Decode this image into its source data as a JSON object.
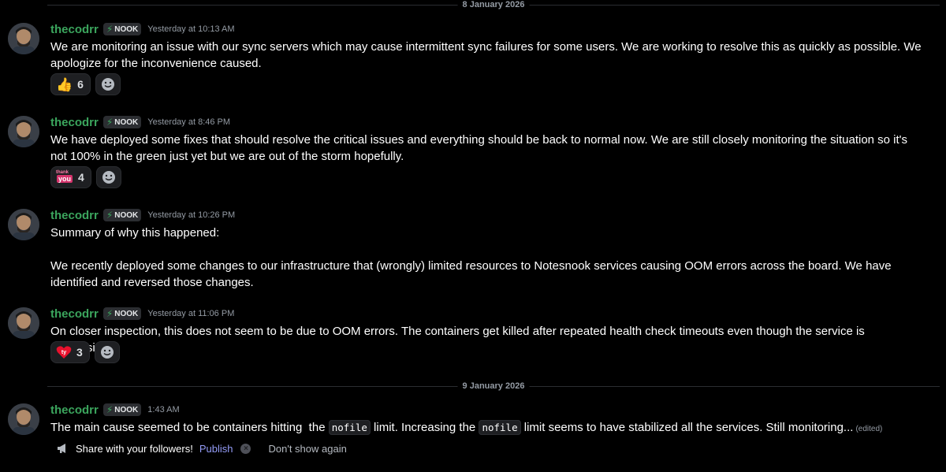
{
  "dividers": [
    "8 January 2026",
    "9 January 2026"
  ],
  "icons": {
    "bolt": "lightning-bolt-icon",
    "add_reaction": "smiley-add-reaction-icon",
    "megaphone": "megaphone-icon",
    "dismiss": "close-circle-icon"
  },
  "colors": {
    "username": "#3ba55d",
    "link": "#949cf7",
    "background": "#000000"
  },
  "messages": [
    {
      "author": "thecodrr",
      "tag": "NOOK",
      "time": "Yesterday at 10:13 AM",
      "paragraphs": [
        "We are monitoring an issue with our sync servers which may cause intermittent sync failures for some users. We are working to resolve this as quickly as possible. We apologize for the inconvenience caused."
      ],
      "reaction": {
        "emoji": "👍",
        "count": "6"
      }
    },
    {
      "author": "thecodrr",
      "tag": "NOOK",
      "time": "Yesterday at 8:46 PM",
      "paragraphs": [
        "We have deployed some fixes that should resolve the critical issues and everything should be back to normal now. We are still closely monitoring the situation so it's not 100% in the green just yet but we are out of the storm hopefully."
      ],
      "reaction": {
        "emoji": "thank-you-sticker",
        "sticker_top": "thank",
        "sticker_bottom": "you",
        "count": "4"
      }
    },
    {
      "author": "thecodrr",
      "tag": "NOOK",
      "time": "Yesterday at 10:26 PM",
      "paragraphs": [
        "Summary of why this happened:",
        "We recently deployed some changes to our infrastructure that (wrongly) limited resources to Notesnook services causing OOM errors across the board. We have identified and reversed those changes."
      ]
    },
    {
      "author": "thecodrr",
      "tag": "NOOK",
      "time": "Yesterday at 11:06 PM",
      "paragraphs": [
        "On closer inspection, this does not seem to be due to OOM errors. The containers get killed after repeated health check timeouts even though the service is responsive."
      ],
      "reaction": {
        "emoji": "ty-emoji",
        "label": "ty",
        "count": "3"
      }
    },
    {
      "author": "thecodrr",
      "tag": "NOOK",
      "time": "1:43 AM",
      "text_parts": [
        "The main cause seemed to be containers hitting  the ",
        "nofile",
        " limit. Increasing the ",
        "nofile",
        " limit seems to have stabilized all the services. Still monitoring..."
      ],
      "edited": "(edited)"
    }
  ],
  "share_bar": {
    "text": "Share with your followers!",
    "publish": "Publish",
    "dont_show": "Don't show again"
  }
}
